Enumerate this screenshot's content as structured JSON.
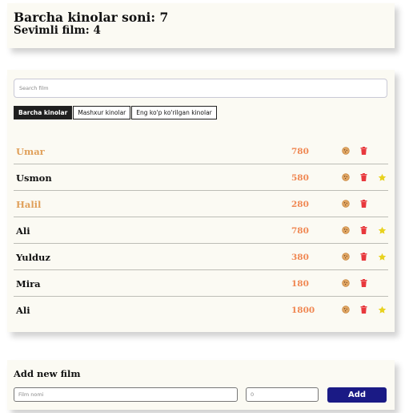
{
  "info": {
    "total_label": "Barcha kinolar soni: 7",
    "favorite_label": "Sevimli film: 4"
  },
  "search": {
    "placeholder": "Search film"
  },
  "tabs": [
    {
      "label": "Barcha kinolar",
      "active": true
    },
    {
      "label": "Mashxur kinolar",
      "active": false
    },
    {
      "label": "Eng ko'p ko'rilgan kinolar",
      "active": false
    }
  ],
  "films": [
    {
      "name": "Umar",
      "views": "780",
      "increase": true,
      "like": false
    },
    {
      "name": "Usmon",
      "views": "580",
      "increase": false,
      "like": true
    },
    {
      "name": "Halil",
      "views": "280",
      "increase": true,
      "like": false
    },
    {
      "name": "Ali",
      "views": "780",
      "increase": false,
      "like": true
    },
    {
      "name": "Yulduz",
      "views": "380",
      "increase": false,
      "like": true
    },
    {
      "name": "Mira",
      "views": "180",
      "increase": false,
      "like": false
    },
    {
      "name": "Ali",
      "views": "1800",
      "increase": false,
      "like": true
    }
  ],
  "icons": {
    "cookie": "cookie-icon",
    "trash": "trash-icon",
    "star": "star-icon"
  },
  "colors": {
    "increase": "#e0a05a",
    "views": "#f08752",
    "trash": "#e8383d",
    "star": "#e8d21e",
    "add_button": "#1a1a85"
  },
  "add_form": {
    "title": "Add new film",
    "name_placeholder": "Film nomi",
    "count_placeholder": "0",
    "button_label": "Add"
  }
}
